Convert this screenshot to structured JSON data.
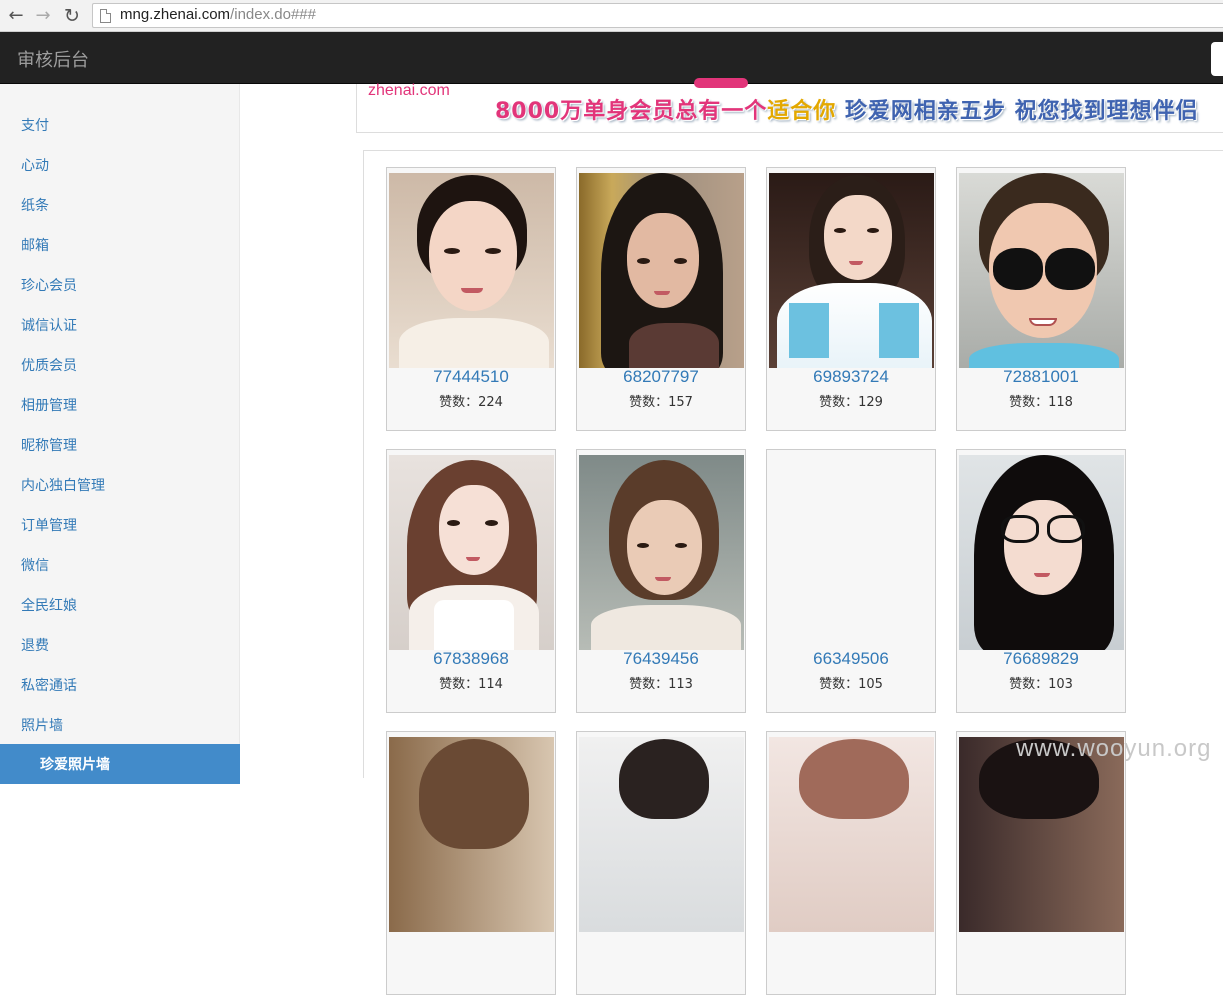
{
  "browser": {
    "url_host": "mng.zhenai.com",
    "url_path": "/index.do###"
  },
  "header": {
    "title": "审核后台"
  },
  "sidebar": {
    "items": [
      {
        "label": "支付"
      },
      {
        "label": "心动"
      },
      {
        "label": "纸条"
      },
      {
        "label": "邮箱"
      },
      {
        "label": "珍心会员"
      },
      {
        "label": "诚信认证"
      },
      {
        "label": "优质会员"
      },
      {
        "label": "相册管理"
      },
      {
        "label": "昵称管理"
      },
      {
        "label": "内心独白管理"
      },
      {
        "label": "订单管理"
      },
      {
        "label": "微信"
      },
      {
        "label": "全民红娘"
      },
      {
        "label": "退费"
      },
      {
        "label": "私密通话"
      },
      {
        "label": "照片墙"
      }
    ],
    "active_item": "珍爱照片墙"
  },
  "banner": {
    "logo": "zhenai.com",
    "slogan_part1": "8000万单身会员总有一个",
    "slogan_part2": "适合你",
    "slogan_part3": "珍爱网相亲五步 祝您找到理想伴侣"
  },
  "likes_prefix": "赞数：",
  "photos": [
    {
      "id": "77444510",
      "likes": "224"
    },
    {
      "id": "68207797",
      "likes": "157"
    },
    {
      "id": "69893724",
      "likes": "129"
    },
    {
      "id": "72881001",
      "likes": "118"
    },
    {
      "id": "67838968",
      "likes": "114"
    },
    {
      "id": "76439456",
      "likes": "113"
    },
    {
      "id": "66349506",
      "likes": "105"
    },
    {
      "id": "76689829",
      "likes": "103"
    }
  ],
  "watermark": "www.wooyun.org",
  "colors": {
    "link": "#337ab7",
    "header_bg": "#222222",
    "active_bg": "#428bca",
    "brand_pink": "#e2357a"
  }
}
